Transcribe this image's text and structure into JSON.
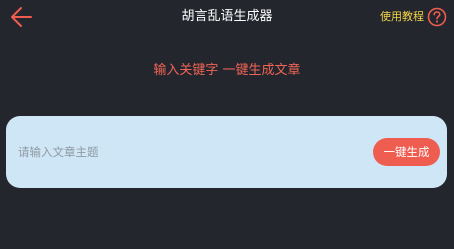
{
  "header": {
    "title": "胡言乱语生成器",
    "help_label": "使用教程",
    "back_icon": "arrow-left-icon",
    "help_icon": "question-circle-icon"
  },
  "main": {
    "subtitle": "输入关键字  一键生成文章",
    "input": {
      "placeholder": "请输入文章主题",
      "value": ""
    },
    "generate_button_label": "一键生成"
  },
  "colors": {
    "background": "#23262d",
    "accent": "#ef5c50",
    "help_text": "#f2d44a",
    "card": "#cfe6f6"
  }
}
